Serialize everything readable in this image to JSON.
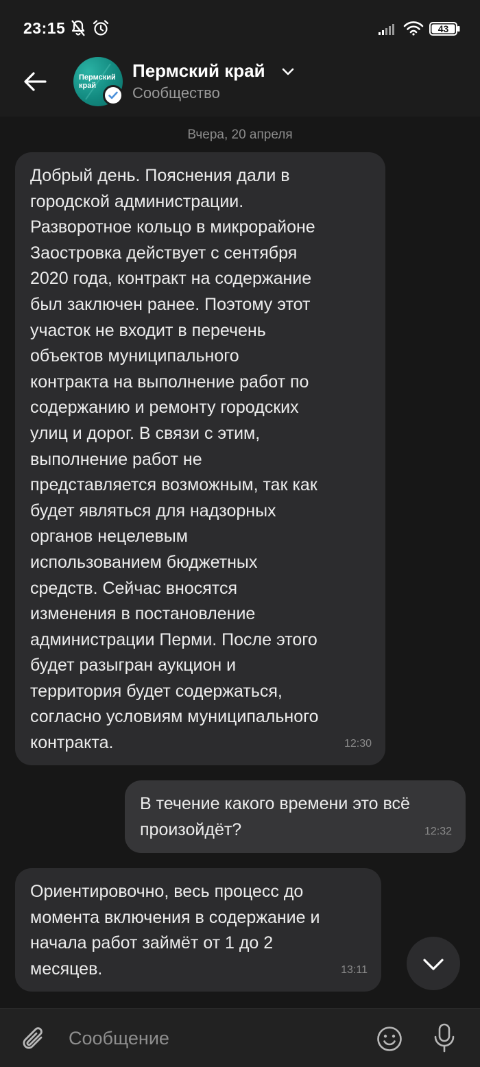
{
  "status_bar": {
    "time": "23:15",
    "battery": "43",
    "icons": [
      "notifications-off-icon",
      "alarm-icon",
      "signal-icon",
      "wifi-icon",
      "battery-icon"
    ]
  },
  "header": {
    "title": "Пермский край",
    "subtitle": "Сообщество",
    "avatar_text": "Пермский край",
    "icons": [
      "back-arrow-icon",
      "chevron-down-icon",
      "verified-check-icon"
    ]
  },
  "feed": {
    "date_separator": "Вчера, 20 апреля",
    "messages": [
      {
        "direction": "incoming",
        "text": "Добрый день. Пояснения дали в\nгородской администрации.\nРазворотное кольцо в микрорайоне\nЗаостровка действует с сентября\n2020 года, контракт на содержание\nбыл заключен ранее. Поэтому этот\nучасток не входит в перечень\nобъектов муниципального\nконтракта на выполнение работ по\nсодержанию и ремонту городских\nулиц и дорог. В связи с этим,\nвыполнение работ не\nпредставляется возможным, так как\nбудет являться для надзорных\nорганов  нецелевым\nиспользованием бюджетных\nсредств. Сейчас вносятся\nизменения в постановление\nадминистрации  Перми. После этого\nбудет разыгран аукцион и\nтерритория будет содержаться,\nсогласно условиям муниципального\nконтракта.",
        "time": "12:30"
      },
      {
        "direction": "outgoing",
        "text": "В течение какого времени это всё\nпроизойдёт?",
        "time": "12:32"
      },
      {
        "direction": "incoming",
        "text": "Ориентировочно, весь процесс до\nмомента включения в содержание и\nначала работ займёт от 1 до 2\nмесяцев.",
        "time": "13:11"
      }
    ]
  },
  "composer": {
    "placeholder": "Сообщение",
    "value": "",
    "icons": [
      "paperclip-icon",
      "emoji-icon",
      "microphone-icon",
      "chevron-down-icon"
    ]
  },
  "colors": {
    "background": "#171717",
    "incoming_bubble": "#2c2c2e",
    "outgoing_bubble": "#363638",
    "avatar_teal": "#138a80",
    "verified_blue": "#4a8fd9"
  }
}
